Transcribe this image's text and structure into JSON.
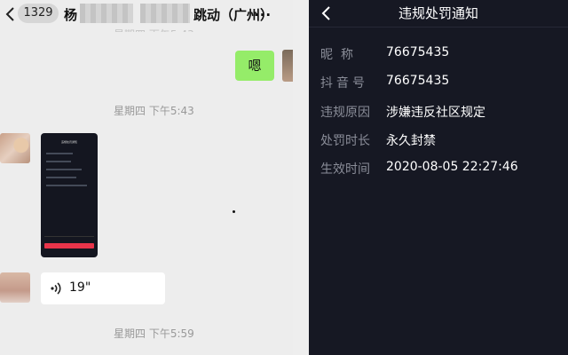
{
  "chat": {
    "unread_count": "1329",
    "title_left": "杨",
    "title_right": "跳动（广州）",
    "title_more": "...",
    "my_message": "嗯",
    "timestamps": [
      "星期四 下午5:43",
      "星期四 下午5:59"
    ],
    "voice_duration": "19\"",
    "thumbnail_title": "违规处罚通知"
  },
  "notice": {
    "title": "违规处罚通知",
    "rows": [
      {
        "label": "昵称",
        "value": "76675435"
      },
      {
        "label": "抖音号",
        "value": "76675435"
      },
      {
        "label": "违规原因",
        "value": "涉嫌违反社区规定"
      },
      {
        "label": "处罚时长",
        "value": "永久封禁"
      },
      {
        "label": "生效时间",
        "value": "2020-08-05 22:27:46"
      }
    ]
  },
  "colors": {
    "chat_bg": "#ededed",
    "my_bubble": "#95ec69",
    "notice_bg": "#161823",
    "notice_label": "#8a8d98",
    "punish_button": "#e8344a"
  },
  "icons": [
    "chevron-left-icon",
    "voice-wave-icon"
  ]
}
